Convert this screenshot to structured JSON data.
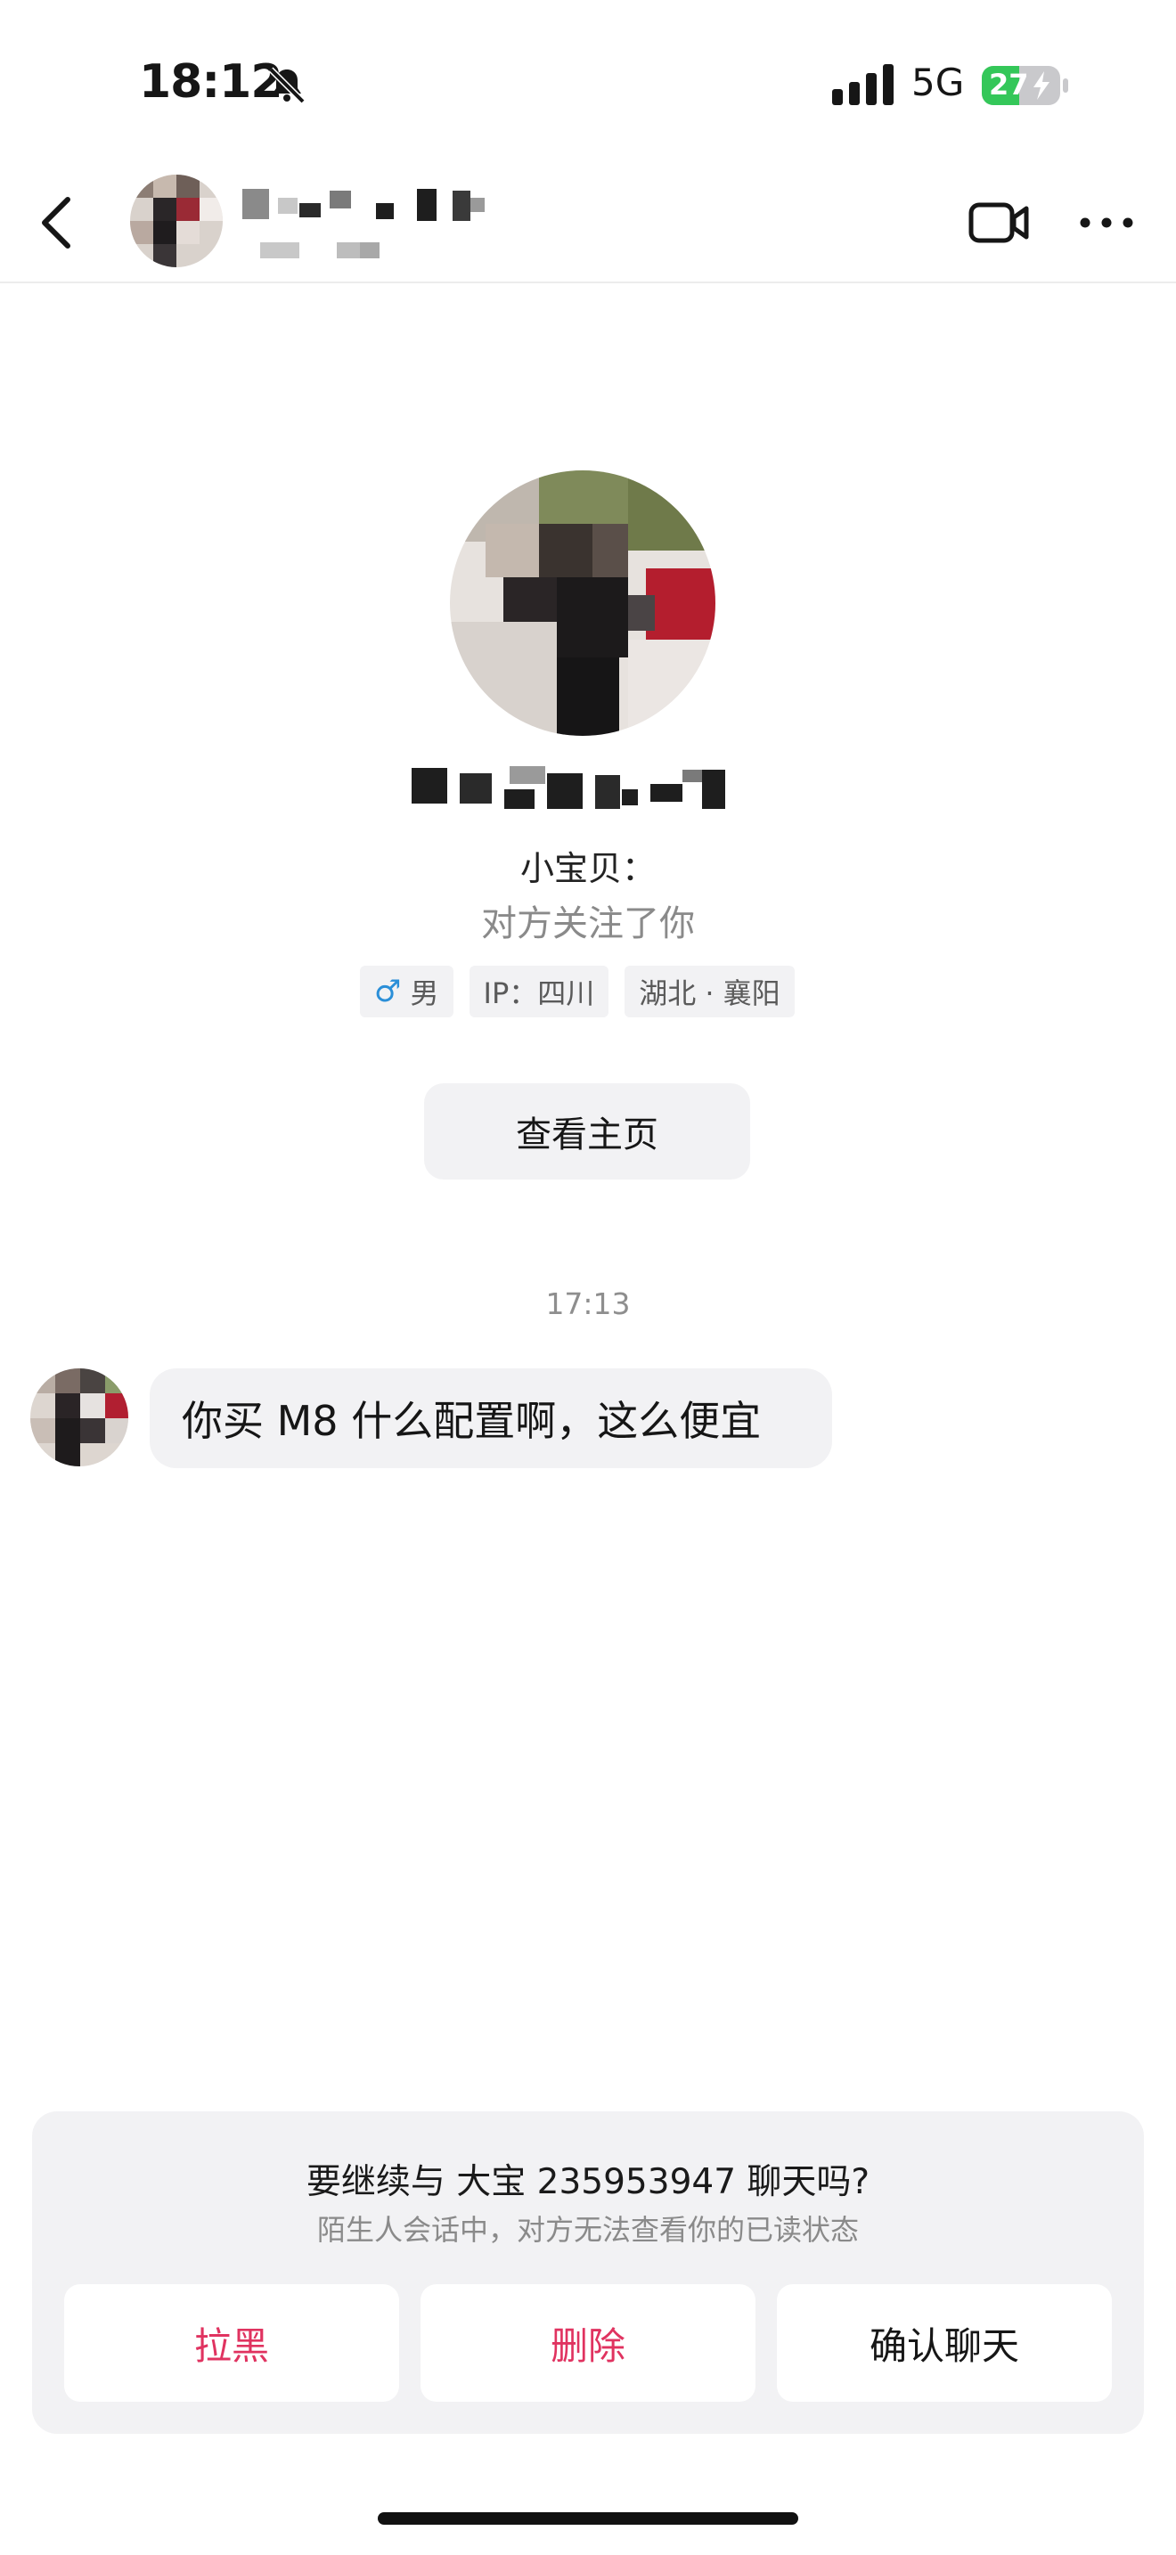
{
  "status_bar": {
    "time": "18:12",
    "network": "5G",
    "battery": "27"
  },
  "profile": {
    "follow_label": "小宝贝：",
    "follow_status": "对方关注了你",
    "tags": {
      "gender": "男",
      "ip": "IP：四川",
      "location": "湖北 · 襄阳"
    },
    "view_home_label": "查看主页"
  },
  "conversation": {
    "timestamp": "17:13",
    "messages": [
      {
        "text": "你买 M8 什么配置啊，这么便宜"
      }
    ]
  },
  "stranger_prompt": {
    "title": "要继续与 大宝 235953947 聊天吗?",
    "subtitle": "陌生人会话中，对方无法查看你的已读状态",
    "block_label": "拉黑",
    "delete_label": "删除",
    "confirm_label": "确认聊天"
  },
  "colors": {
    "accent_red": "#e03360",
    "battery_green": "#34c759",
    "male_blue": "#2b8fd8"
  },
  "icons": [
    "bell-muted-icon",
    "signal-icon",
    "battery-icon",
    "back-chevron-icon",
    "video-camera-icon",
    "more-dots-icon"
  ]
}
